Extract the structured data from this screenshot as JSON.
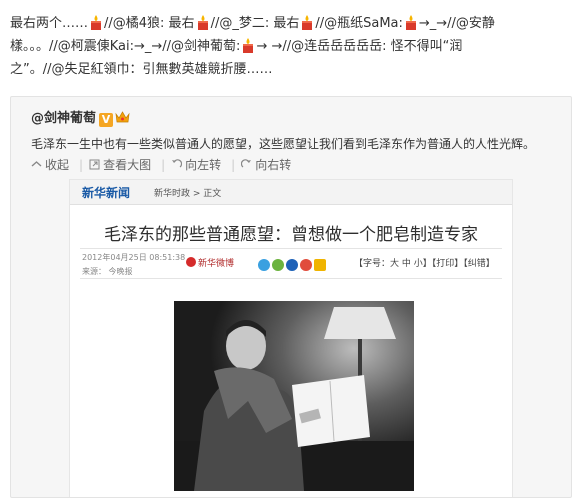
{
  "post": {
    "seg1": "最右两个……",
    "seg2": "//@橘4狼: 最右",
    "seg3": "//@_梦二: 最右",
    "seg4": "//@瓶纸SaMa:",
    "seg5": "→_→//@安静",
    "seg6": "樣。。。//@柯震倲Kai:→_→//@剑神葡萄:",
    "seg7": "→ →//@连岳岳岳岳岳: 怪不得叫“润",
    "seg8": "之”。//@失足紅領巾：引無數英雄競折腰……"
  },
  "repost": {
    "author": "@剑神葡萄",
    "v_badge": "V",
    "text": "毛泽东一生中也有一些类似普通人的愿望，这些愿望让我们看到毛泽东作为普通人的人性光辉。",
    "actions": [
      "收起",
      "查看大图",
      "向左转",
      "向右转"
    ],
    "icons": [
      "collapse-icon",
      "zoom-icon",
      "rotate-left-icon",
      "rotate-right-icon"
    ]
  },
  "article": {
    "site_logo": "新华新闻",
    "breadcrumb": "新华时政 > 正文",
    "headline": "毛泽东的那些普通愿望：曾想做一个肥皂制造专家",
    "date": "2012年04月25日  08:51:38",
    "source": "来源：  今晚报",
    "weibo": "新华微博",
    "font_control": "【字号：大  中  小】【打印】【纠错】"
  },
  "colors": {
    "accent_orange": "#f5a623",
    "link_blue": "#1a5aa6"
  }
}
